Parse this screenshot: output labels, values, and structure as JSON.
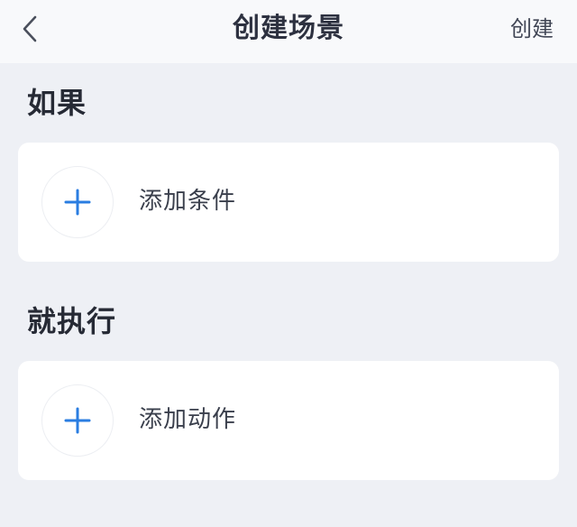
{
  "header": {
    "title": "创建场景",
    "create_label": "创建",
    "back_icon": "chevron-left-icon"
  },
  "if_section": {
    "title": "如果",
    "card_label": "添加条件",
    "icon": "plus-icon"
  },
  "then_section": {
    "title": "就执行",
    "card_label": "添加动作",
    "icon": "plus-icon"
  },
  "colors": {
    "page_background": "#eef0f5",
    "header_background": "#f8f9fb",
    "card_background": "#ffffff",
    "accent_blue": "#2a7de1",
    "title_text": "#2d3140",
    "section_text": "#262a35"
  }
}
